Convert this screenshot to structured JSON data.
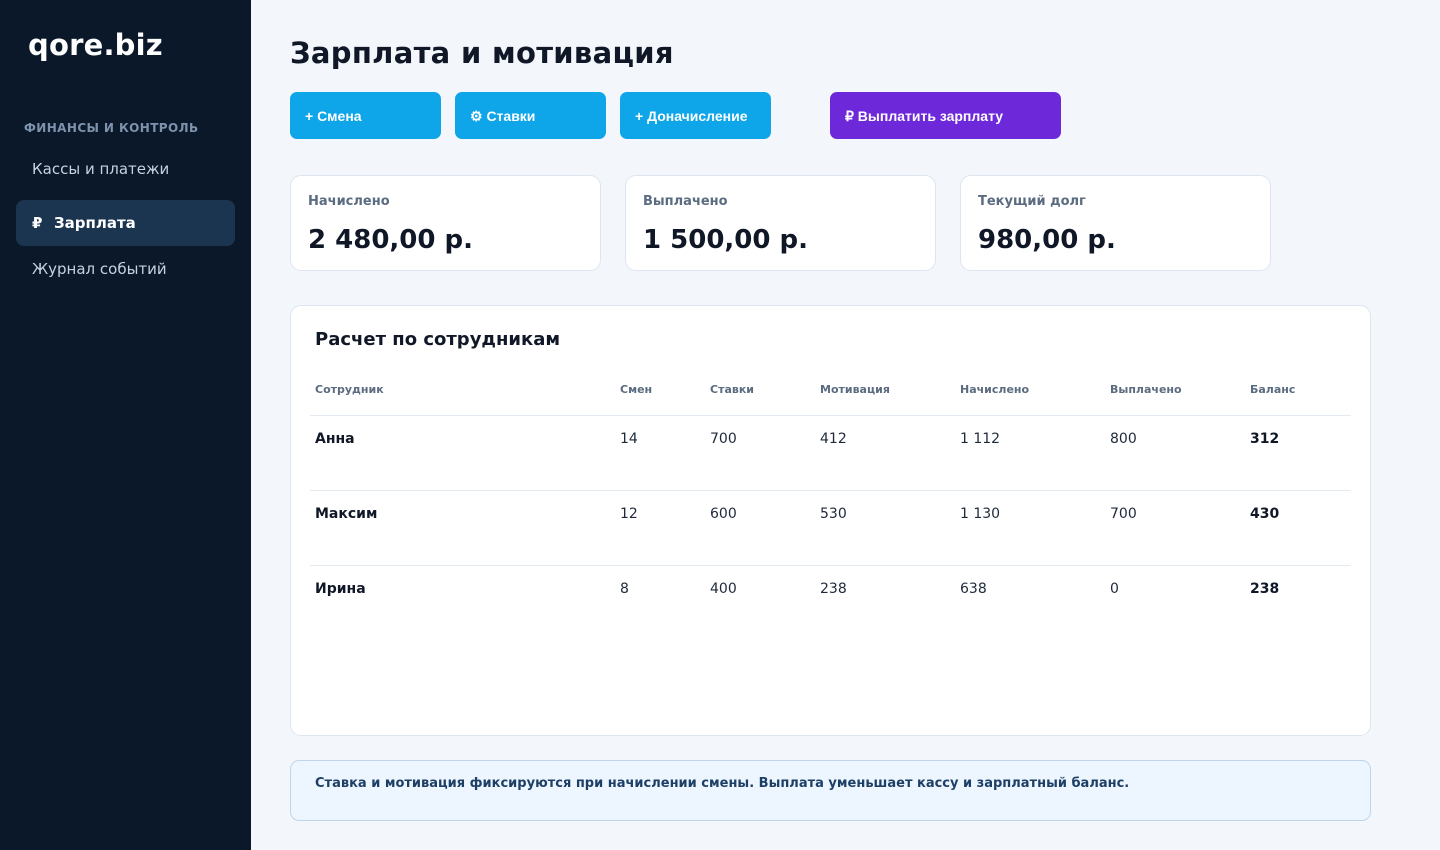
{
  "app": {
    "logo": "qore.biz"
  },
  "sidebar": {
    "section_label": "ФИНАНСЫ И КОНТРОЛЬ",
    "items": [
      {
        "label": "Кассы и платежи",
        "icon": "",
        "active": false
      },
      {
        "label": "Зарплата",
        "icon": "₽",
        "active": true
      },
      {
        "label": "Журнал событий",
        "icon": "",
        "active": false
      }
    ]
  },
  "page": {
    "title": "Зарплата и мотивация"
  },
  "toolbar": {
    "shift_label": "+ Смена",
    "rates_label": "⚙ Ставки",
    "accrual_label": "+ Доначисление",
    "pay_label": "₽ Выплатить зарплату"
  },
  "stats": [
    {
      "label": "Начислено",
      "value": "2 480,00 р."
    },
    {
      "label": "Выплачено",
      "value": "1 500,00 р."
    },
    {
      "label": "Текущий долг",
      "value": "980,00 р."
    }
  ],
  "table": {
    "title": "Расчет по сотрудникам",
    "columns": [
      "Сотрудник",
      "Смен",
      "Ставки",
      "Мотивация",
      "Начислено",
      "Выплачено",
      "Баланс"
    ],
    "rows": [
      [
        "Анна",
        "14",
        "700",
        "412",
        "1 112",
        "800",
        "312"
      ],
      [
        "Максим",
        "12",
        "600",
        "530",
        "1 130",
        "700",
        "430"
      ],
      [
        "Ирина",
        "8",
        "400",
        "238",
        "638",
        "0",
        "238"
      ]
    ]
  },
  "note": {
    "text": "Ставка и мотивация фиксируются при начислении смены. Выплата уменьшает кассу и зарплатный баланс."
  },
  "colors": {
    "sidebar_bg": "#0b1829",
    "sidebar_active": "#1b3551",
    "accent_blue": "#0ea5e9",
    "accent_purple": "#6d28d9",
    "page_bg": "#f3f6fb"
  }
}
